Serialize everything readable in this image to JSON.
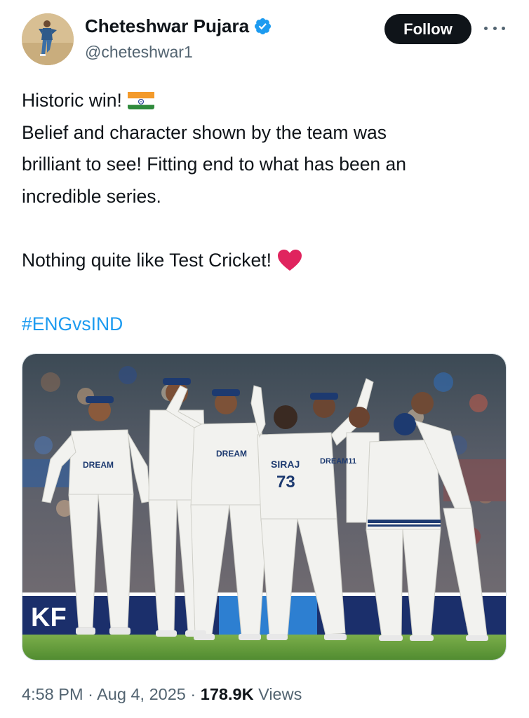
{
  "header": {
    "display_name": "Cheteshwar Pujara",
    "handle": "@cheteshwar1",
    "follow_label": "Follow",
    "verified_color": "#1d9bf0"
  },
  "tweet": {
    "line1": "Historic win!",
    "line2": "Belief and character shown by the team was",
    "line3": "brilliant to see! Fitting end to what has been an",
    "line4": "incredible series.",
    "line5": "Nothing quite like Test Cricket!",
    "hashtag": "#ENGvsIND",
    "emoji": [
      "india-flag-icon",
      "red-heart-icon"
    ]
  },
  "media": {
    "description_icon": "cricket-team-celebration-photo",
    "shirt_texts": [
      "DREAM",
      "DREAM",
      "SIRAJ",
      "73",
      "DREAM",
      "DREAM11"
    ],
    "board_text": "KF"
  },
  "meta": {
    "time": "4:58 PM",
    "separator": "·",
    "date": "Aug 4, 2025",
    "views_count": "178.9K",
    "views_label": "Views"
  },
  "colors": {
    "text_primary": "#0f1419",
    "text_secondary": "#536471",
    "accent": "#1d9bf0",
    "heart": "#e0245e"
  }
}
